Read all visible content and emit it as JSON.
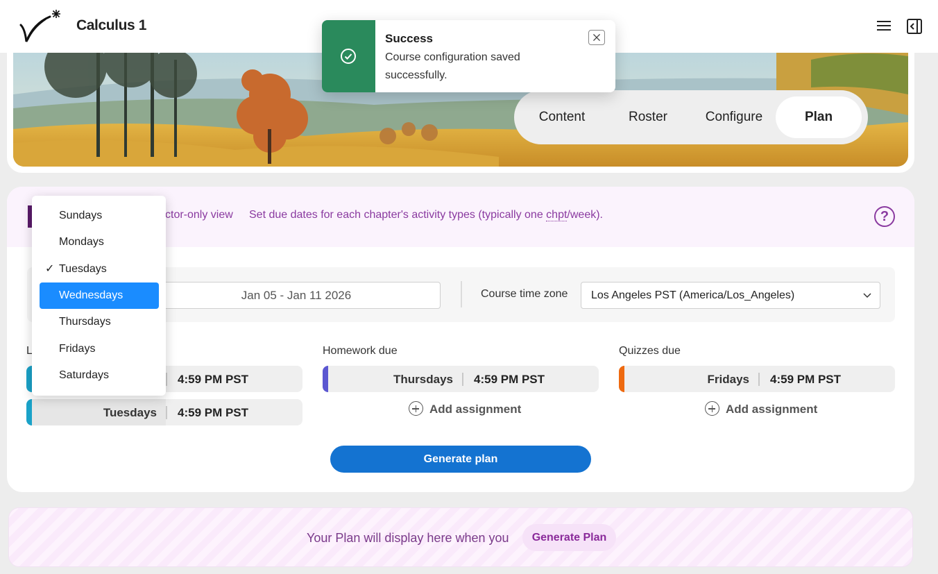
{
  "app": {
    "title": "Calculus 1"
  },
  "header": {
    "menu_icon": "hamburger-menu-icon",
    "panel_icon": "side-panel-icon"
  },
  "tabs": [
    {
      "label": "Content"
    },
    {
      "label": "Roster"
    },
    {
      "label": "Configure"
    },
    {
      "label": "Plan",
      "active": true
    }
  ],
  "toast": {
    "title": "Success",
    "message": "Course configuration saved successfully.",
    "color": "#2a8a5c"
  },
  "plan": {
    "heading_letter": "L",
    "instructor_note": "ctor-only view",
    "description_pre": "Set due dates for each chapter's activity types (typically one ",
    "description_chpt": "chpt",
    "description_post": "/week).",
    "help_label": "?",
    "week_range": "Jan 05 - Jan 11 2026",
    "timezone_label": "Course time zone",
    "timezone_value": "Los Angeles PST (America/Los_Angeles)",
    "columns": {
      "lectures": {
        "label": "L",
        "color": "#1aa2c8",
        "rows": [
          {
            "day": "",
            "time": "4:59 PM PST"
          },
          {
            "day": "Tuesdays",
            "time": "4:59 PM PST"
          }
        ]
      },
      "homework": {
        "label": "Homework due",
        "color": "#5b57d1",
        "rows": [
          {
            "day": "Thursdays",
            "time": "4:59 PM PST"
          }
        ],
        "add_label": "Add assignment"
      },
      "quizzes": {
        "label": "Quizzes due",
        "color": "#ee6a10",
        "rows": [
          {
            "day": "Fridays",
            "time": "4:59 PM PST"
          }
        ],
        "add_label": "Add assignment"
      }
    },
    "generate_label": "Generate plan"
  },
  "dropdown": {
    "options": [
      "Sundays",
      "Mondays",
      "Tuesdays",
      "Wednesdays",
      "Thursdays",
      "Fridays",
      "Saturdays"
    ],
    "selected": "Tuesdays",
    "highlighted": "Wednesdays",
    "check_glyph": "✓"
  },
  "placeholder": {
    "text": "Your Plan will display here when you",
    "button": "Generate Plan"
  }
}
